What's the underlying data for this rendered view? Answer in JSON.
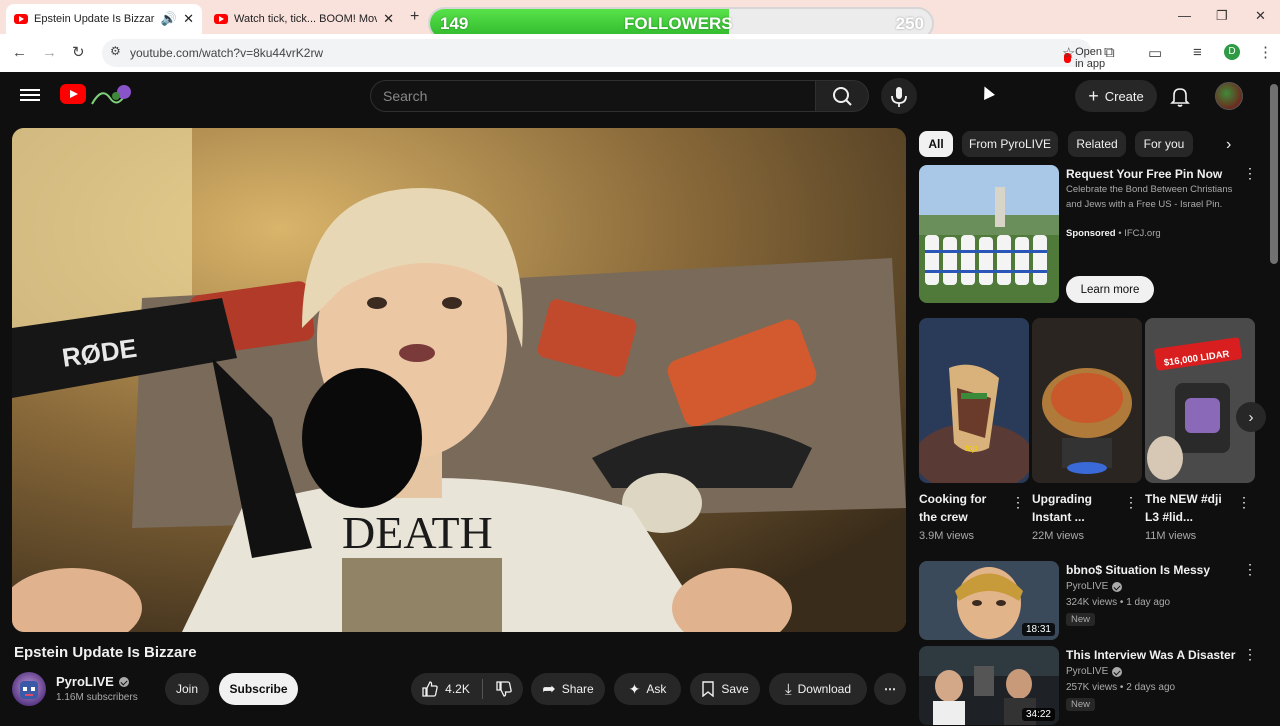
{
  "browser": {
    "tabs": [
      {
        "title": "Epstein Update Is Bizzare - Y",
        "active": true
      },
      {
        "title": "Watch tick, tick... BOOM! Movie",
        "active": false
      }
    ],
    "new_tab": "+",
    "url": "youtube.com/watch?v=8ku44vrK2rw",
    "open_in_app": "Open in app",
    "window_controls": [
      "—",
      "❐",
      "✕"
    ]
  },
  "followers_overlay": {
    "current": "149",
    "label": "FOLLOWERS",
    "goal": "250",
    "progress": 0.596,
    "colors": {
      "fill": "#3fcf3a",
      "track": "#ececec"
    }
  },
  "header": {
    "search_placeholder": "Search",
    "create_label": "Create"
  },
  "video": {
    "title": "Epstein Update Is Bizzare",
    "shirt_text": "DEATH",
    "mic_brand": "RØDE"
  },
  "channel": {
    "name": "PyroLIVE",
    "subscribers": "1.16M subscribers",
    "join_label": "Join",
    "subscribe_label": "Subscribe"
  },
  "actions": {
    "likes": "4.2K",
    "share": "Share",
    "ask": "Ask",
    "save": "Save",
    "download": "Download"
  },
  "chips": [
    "All",
    "From PyroLIVE",
    "Related",
    "For you"
  ],
  "ad": {
    "title": "Request Your Free Pin Now",
    "description": "Celebrate the Bond Between Christians and Jews with a Free US - Israel Pin.",
    "sponsored": "Sponsored",
    "domain": "IFCJ.org",
    "cta": "Learn more"
  },
  "shorts": [
    {
      "title": "Cooking for the crew",
      "views": "3.9M views",
      "overlay": "top"
    },
    {
      "title": "Upgrading Instant ...",
      "views": "22M views",
      "overlay": ""
    },
    {
      "title": "The NEW #dji L3 #lid...",
      "views": "11M views",
      "overlay": "$16,000 LIDAR"
    }
  ],
  "recommendations": [
    {
      "title": "bbno$ Situation Is Messy",
      "channel": "PyroLIVE",
      "meta": "324K views • 1 day ago",
      "badge": "New",
      "duration": "18:31"
    },
    {
      "title": "This Interview Was A Disaster",
      "channel": "PyroLIVE",
      "meta": "257K views • 2 days ago",
      "badge": "New",
      "duration": "34:22"
    }
  ],
  "colors": {
    "youtube_red": "#ff0000",
    "background": "#0f0f0f",
    "tabstrip": "#f9e1dc"
  }
}
